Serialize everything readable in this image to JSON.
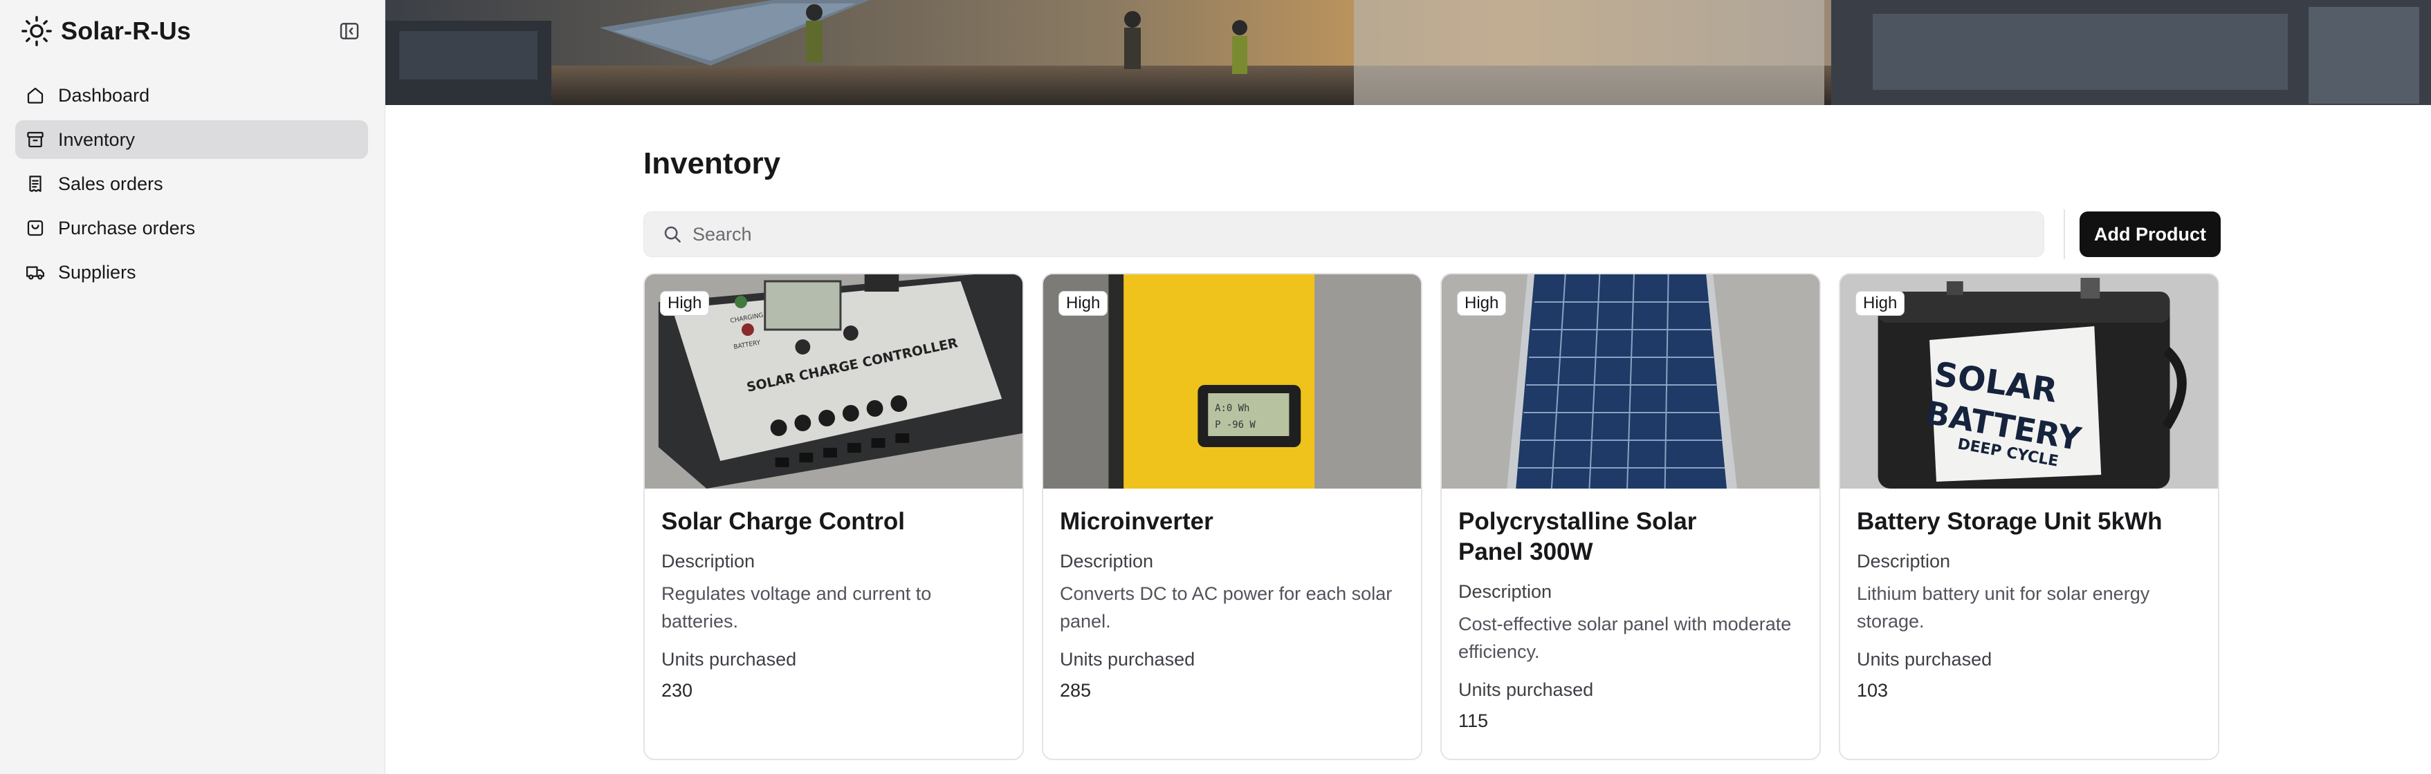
{
  "app": {
    "name": "Solar-R-Us"
  },
  "sidebar": {
    "items": [
      {
        "label": "Dashboard",
        "icon": "home-icon"
      },
      {
        "label": "Inventory",
        "icon": "archive-box-icon",
        "active": true
      },
      {
        "label": "Sales orders",
        "icon": "receipt-icon"
      },
      {
        "label": "Purchase orders",
        "icon": "shopping-bag-icon"
      },
      {
        "label": "Suppliers",
        "icon": "truck-icon"
      }
    ]
  },
  "main": {
    "title": "Inventory",
    "search": {
      "placeholder": "Search",
      "value": ""
    },
    "add_button": "Add Product",
    "field_labels": {
      "description": "Description",
      "units": "Units purchased"
    },
    "products": [
      {
        "badge": "High",
        "name": "Solar Charge Control",
        "description": "Regulates voltage and current to batteries.",
        "units": "230"
      },
      {
        "badge": "High",
        "name": "Microinverter",
        "description": "Converts DC to AC power for each solar panel.",
        "units": "285"
      },
      {
        "badge": "High",
        "name": "Polycrystalline Solar Panel 300W",
        "description": "Cost-effective solar panel with moderate efficiency.",
        "units": "115"
      },
      {
        "badge": "High",
        "name": "Battery Storage Unit 5kWh",
        "description": "Lithium battery unit for solar energy storage.",
        "units": "103"
      }
    ],
    "product_images": {
      "controller_text": "SOLAR CHARGE CONTROLLER",
      "controller_led1": "CHARGING",
      "controller_led2": "BATTERY",
      "battery_text_1": "SOLAR",
      "battery_text_2": "BATTERY",
      "battery_text_3": "DEEP CYCLE"
    }
  },
  "colors": {
    "accent": "#111111",
    "sidebar_bg": "#f4f4f5",
    "active_item": "#dcdcde"
  }
}
